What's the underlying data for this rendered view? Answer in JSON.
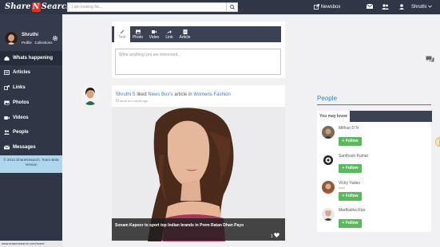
{
  "topbar": {
    "logo_left": "Share",
    "logo_mid": "N",
    "logo_right": "Search",
    "search_placeholder": "I am looking for...",
    "newsbox_label": "Newsbox",
    "user_menu_label": "Shruthi"
  },
  "sidebar": {
    "user_name": "Shruthi",
    "profile_link": "Profile",
    "collections_link": "Collections",
    "items": [
      {
        "label": "Whats happening",
        "icon": "home-icon"
      },
      {
        "label": "Articles",
        "icon": "article-icon"
      },
      {
        "label": "Links",
        "icon": "link-icon"
      },
      {
        "label": "Photos",
        "icon": "photo-icon"
      },
      {
        "label": "Videos",
        "icon": "video-icon"
      },
      {
        "label": "People",
        "icon": "people-icon"
      },
      {
        "label": "Messages",
        "icon": "envelope-icon"
      }
    ],
    "copyright": "© 2014 ShareNSearch. Team Beta Version",
    "status_url": "www.sharensearch.com/home"
  },
  "composer": {
    "tabs": [
      {
        "label": "Text"
      },
      {
        "label": "Photo"
      },
      {
        "label": "Video"
      },
      {
        "label": "Link"
      },
      {
        "label": "Article"
      }
    ],
    "placeholder": "Write anything you are interested..."
  },
  "post": {
    "actor": "Shruthi S",
    "verb_1": "liked",
    "owner": "News Box's",
    "verb_2": "article in",
    "category": "Womens Fashion",
    "time": "about an 4 minute ago",
    "caption": "Sonam Kapoor to sport top Indian brands in Prem Ratan Dhan Payo",
    "likes": "1"
  },
  "people": {
    "title": "People",
    "tab_label": "You may know",
    "follow_label": "Follow",
    "list": [
      {
        "name": "Mithun D N",
        "sub": ""
      },
      {
        "name": "Santhosh Kumar",
        "sub": ""
      },
      {
        "name": "Vicky Yadav",
        "sub": "Artist"
      },
      {
        "name": "Madhulika Rao",
        "sub": ""
      }
    ]
  },
  "colors": {
    "navy": "#2f3747",
    "accent_blue": "#3a7ec8",
    "follow_green": "#5cb85c",
    "logo_red": "#d8362b"
  }
}
